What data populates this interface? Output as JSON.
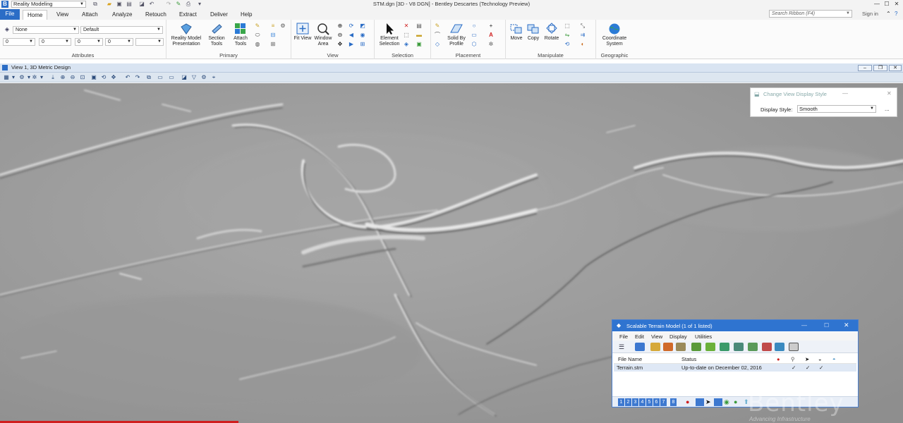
{
  "quick_access": {
    "workflow": "Reality Modeling"
  },
  "window": {
    "title": "STM.dgn [3D - V8 DGN] - Bentley Descartes (Technology Preview)"
  },
  "ribbon_tabs": {
    "file": "File",
    "items": [
      "Home",
      "View",
      "Attach",
      "Analyze",
      "Retouch",
      "Extract",
      "Deliver",
      "Help"
    ],
    "active": "Home",
    "search_placeholder": "Search Ribbon (F4)",
    "sign_in": "Sign in"
  },
  "attributes": {
    "level": "None",
    "style": "Default",
    "color_value": "0",
    "weight_value": "0",
    "linestyle_value": "0",
    "transparency_value": "0",
    "label": "Attributes"
  },
  "primary": {
    "reality_model_presentation": "Reality Model Presentation",
    "section_tools": "Section Tools",
    "attach_tools": "Attach Tools",
    "label": "Primary"
  },
  "view_group": {
    "fit_view": "Fit View",
    "window_area": "Window Area",
    "label": "View"
  },
  "selection": {
    "element_selection": "Element Selection",
    "label": "Selection"
  },
  "placement": {
    "solid_by_profile": "Solid By Profile",
    "label": "Placement"
  },
  "manipulate": {
    "move": "Move",
    "copy": "Copy",
    "rotate": "Rotate",
    "label": "Manipulate"
  },
  "geographic": {
    "coordinate_system": "Coordinate System",
    "label": "Geographic"
  },
  "view_window": {
    "title": "View 1, 3D Metric Design"
  },
  "display_style_dialog": {
    "title": "Change View Display Style",
    "label": "Display Style:",
    "value": "Smooth",
    "more": "..."
  },
  "stm_dialog": {
    "title": "Scalable Terrain Model (1 of 1 listed)",
    "menus": [
      "File",
      "Edit",
      "View",
      "Display",
      "Utilities"
    ],
    "columns": [
      "File Name",
      "Status"
    ],
    "rows": [
      {
        "file_name": "Terrain.stm",
        "status": "Up-to-date on December 02, 2016",
        "checks": [
          "✓",
          "✓",
          "✓"
        ]
      }
    ],
    "status_numbers": [
      "1",
      "2",
      "3",
      "4",
      "5",
      "6",
      "7",
      "8"
    ]
  },
  "watermark": {
    "brand": "Bentley",
    "tagline": "Advancing Infrastructure"
  },
  "colors": {
    "accent": "#2b6dc6",
    "dialog_title": "#2f74d0",
    "viewbar": "#d9e4f2"
  }
}
